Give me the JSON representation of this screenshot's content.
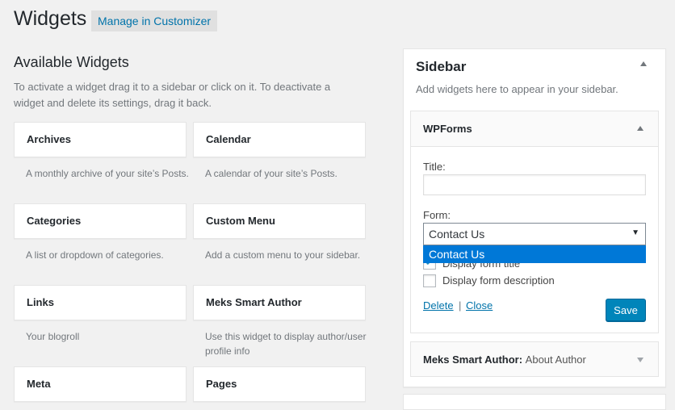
{
  "header": {
    "title": "Widgets",
    "customizer_label": "Manage in Customizer"
  },
  "available": {
    "title": "Available Widgets",
    "description": "To activate a widget drag it to a sidebar or click on it. To deactivate a widget and delete its settings, drag it back.",
    "widgets": [
      {
        "label": "Archives",
        "description": "A monthly archive of your site’s Posts."
      },
      {
        "label": "Calendar",
        "description": "A calendar of your site’s Posts."
      },
      {
        "label": "Categories",
        "description": "A list or dropdown of categories."
      },
      {
        "label": "Custom Menu",
        "description": "Add a custom menu to your sidebar."
      },
      {
        "label": "Links",
        "description": "Your blogroll"
      },
      {
        "label": "Meks Smart Author",
        "description": "Use this widget to display author/user profile info"
      },
      {
        "label": "Meta",
        "description": ""
      },
      {
        "label": "Pages",
        "description": ""
      }
    ]
  },
  "sidebar": {
    "title": "Sidebar",
    "description": "Add widgets here to appear in your sidebar.",
    "wpforms": {
      "title": "WPForms",
      "title_label": "Title:",
      "title_value": "",
      "form_label": "Form:",
      "form_selected": "Contact Us",
      "dropdown_option": "Contact Us",
      "show_title_label": "Display form title",
      "show_title_checked": true,
      "show_desc_label": "Display form description",
      "show_desc_checked": false,
      "delete_label": "Delete",
      "separator": "|",
      "close_label": "Close",
      "save_label": "Save"
    },
    "meks": {
      "title": "Meks Smart Author:",
      "subtitle": "About Author"
    }
  },
  "colors": {
    "accent": "#0073aa",
    "save_button": "#0085ba",
    "dropdown_highlight": "#0078d7"
  }
}
